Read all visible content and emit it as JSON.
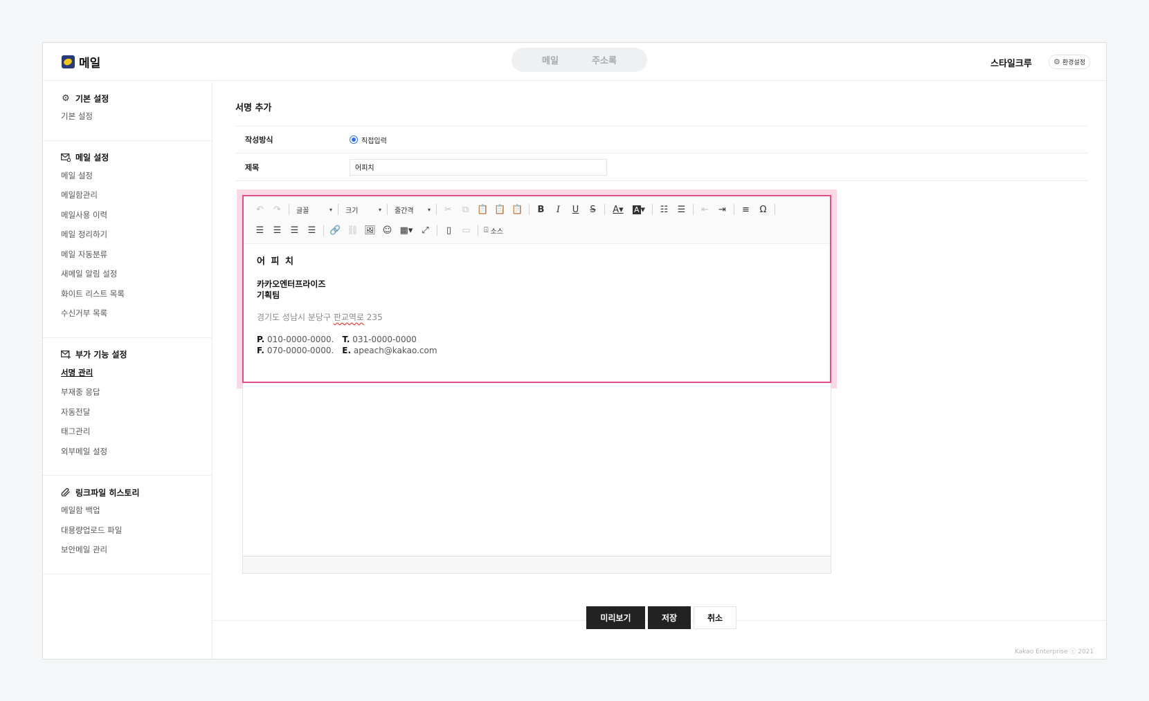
{
  "header": {
    "logo_text": "메일",
    "tabs": [
      {
        "label": "메일"
      },
      {
        "label": "주소록"
      }
    ],
    "user_name": "스타일크루",
    "settings_label": "환경설정"
  },
  "sidebar": {
    "groups": [
      {
        "title": "기본 설정",
        "icon": "gear-icon",
        "items": [
          "기본 설정"
        ]
      },
      {
        "title": "메일 설정",
        "icon": "mail-settings-icon",
        "items": [
          "메일 설정",
          "메일함관리",
          "메일사용 이력",
          "메일 정리하기",
          "메일 자동분류",
          "새메일 알림 설정",
          "화이트 리스트 목록",
          "수신거부 목록"
        ]
      },
      {
        "title": "부가 기능 설정",
        "icon": "mail-plus-icon",
        "items": [
          "서명 관리",
          "부재중 응답",
          "자동전달",
          "태그관리",
          "외부메일 설정"
        ],
        "active_index": 0
      },
      {
        "title": "링크파일 히스토리",
        "icon": "paperclip-icon",
        "items": [
          "메일함 백업",
          "대용량업로드 파일",
          "보안메일 관리"
        ]
      }
    ]
  },
  "main": {
    "title": "서명 추가",
    "form": {
      "method_label": "작성방식",
      "method_value": "직접입력",
      "subject_label": "제목",
      "subject_value": "어피치"
    },
    "toolbar": {
      "font_label": "글꼴",
      "size_label": "크기",
      "line_height_label": "줄간격",
      "source_label": "소스"
    },
    "signature": {
      "name": "어 피 치",
      "company": "카카오엔터프라이즈",
      "team": "기획팀",
      "address_prefix": "경기도 성남시 분당구 ",
      "address_road": "판교역로",
      "address_suffix": " 235",
      "phone_label": "P.",
      "phone": "010-0000-0000.",
      "tel_label": "T.",
      "tel": "031-0000-0000",
      "fax_label": "F.",
      "fax": "070-0000-0000.",
      "email_label": "E.",
      "email": "apeach@kakao.com"
    },
    "buttons": {
      "preview": "미리보기",
      "save": "저장",
      "cancel": "취소"
    }
  },
  "footer": "Kakao Enterprise ⓒ 2021",
  "colors": {
    "highlight_border": "#e14d86",
    "highlight_bg": "#f8d9e5",
    "radio": "#2f6fe0",
    "primary_button": "#222222"
  }
}
